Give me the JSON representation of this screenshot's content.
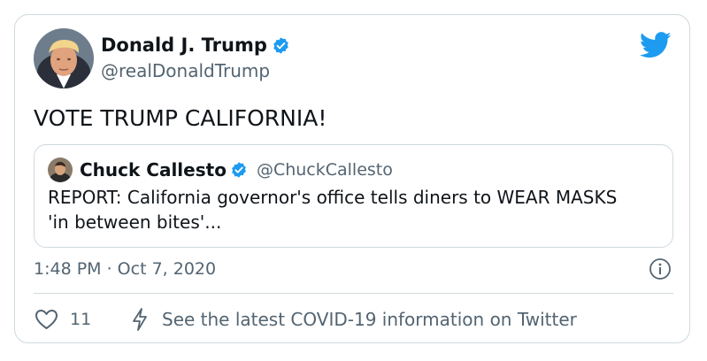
{
  "tweet": {
    "author": {
      "display_name": "Donald J. Trump",
      "handle": "@realDonaldTrump",
      "verified": true
    },
    "text": "VOTE TRUMP CALIFORNIA!",
    "timestamp": "1:48 PM · Oct 7, 2020"
  },
  "quoted_tweet": {
    "author": {
      "display_name": "Chuck Callesto",
      "handle": "@ChuckCallesto",
      "verified": true
    },
    "text": "REPORT: California governor's office tells diners to WEAR MASKS\n'in between bites'..."
  },
  "actions": {
    "like_count": "11",
    "covid_link_text": "See the latest COVID-19 information on Twitter"
  },
  "icons": {
    "verified": "verified-badge-icon",
    "brand": "twitter-bird-icon",
    "info": "info-icon",
    "like": "heart-icon",
    "covid": "lightning-bolt-icon"
  },
  "colors": {
    "brand_blue": "#1d9bf0",
    "text_primary": "#0f1419",
    "text_secondary": "#536471",
    "border": "#cfd9de"
  }
}
